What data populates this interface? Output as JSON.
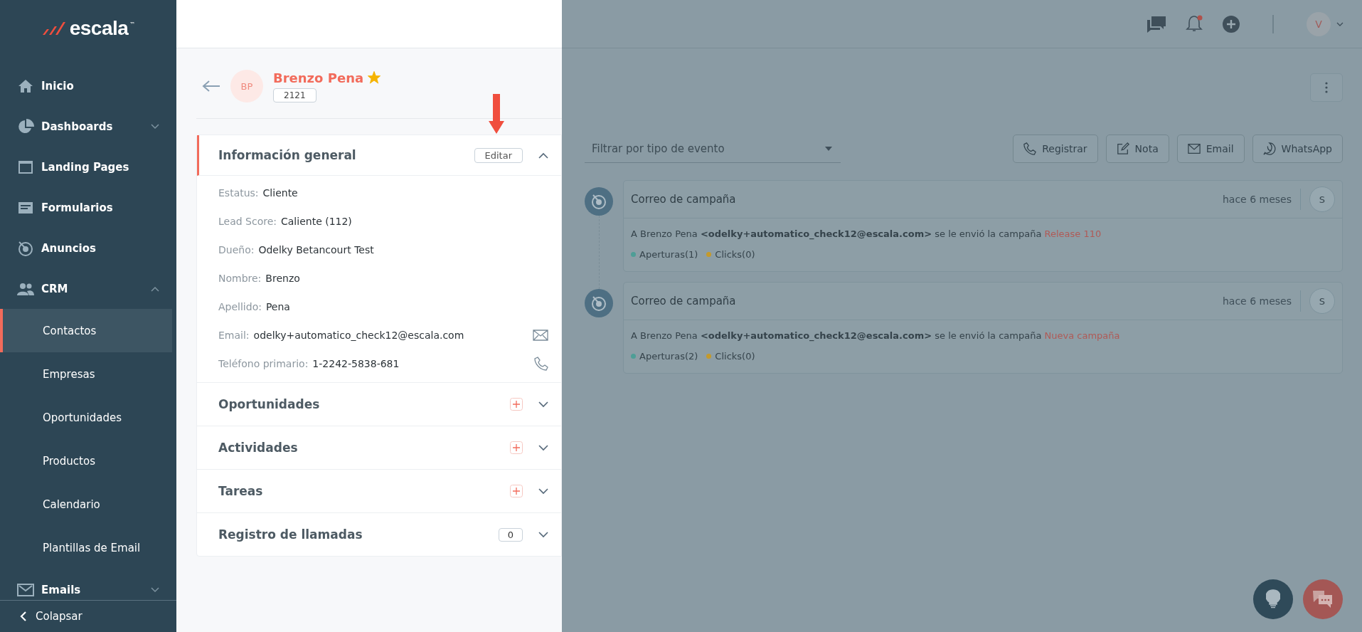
{
  "logo": {
    "text": "escala",
    "mark": "™"
  },
  "sidebar": {
    "items": [
      {
        "label": "Inicio",
        "expandable": false
      },
      {
        "label": "Dashboards",
        "expanded": false,
        "expandable": true
      },
      {
        "label": "Landing Pages",
        "expandable": false
      },
      {
        "label": "Formularios",
        "expandable": false
      },
      {
        "label": "Anuncios",
        "expandable": false
      },
      {
        "label": "CRM",
        "expanded": true,
        "expandable": true,
        "children": [
          {
            "label": "Contactos",
            "selected": true
          },
          {
            "label": "Empresas",
            "selected": false
          },
          {
            "label": "Oportunidades",
            "selected": false
          },
          {
            "label": "Productos",
            "selected": false
          },
          {
            "label": "Calendario",
            "selected": false
          },
          {
            "label": "Plantillas de Email",
            "selected": false
          }
        ]
      },
      {
        "label": "Emails",
        "expanded": false,
        "expandable": true
      }
    ],
    "collapse": "Colapsar"
  },
  "header": {
    "avatar": "V",
    "notification": true
  },
  "contact": {
    "initials": "BP",
    "name": "Brenzo Pena",
    "starred": true,
    "id": "2121",
    "info": {
      "title": "Información general",
      "edit": "Editar",
      "expanded": true,
      "fields": [
        {
          "label": "Estatus:",
          "value": "Cliente"
        },
        {
          "label": "Lead Score:",
          "value": "Caliente (112)"
        },
        {
          "label": "Dueño:",
          "value": "Odelky Betancourt Test"
        },
        {
          "label": "Nombre:",
          "value": "Brenzo"
        },
        {
          "label": "Apellido:",
          "value": "Pena"
        },
        {
          "label": "Email:",
          "value": "odelky+automatico_check12@escala.com",
          "kind": "email"
        },
        {
          "label": "Teléfono primario:",
          "value": "1-2242-5838-681",
          "kind": "phone"
        }
      ]
    },
    "sections": [
      {
        "title": "Oportunidades",
        "kind": "add",
        "expanded": false
      },
      {
        "title": "Actividades",
        "kind": "add",
        "expanded": false
      },
      {
        "title": "Tareas",
        "kind": "add",
        "expanded": false
      },
      {
        "title": "Registro de llamadas",
        "kind": "count",
        "count": "0",
        "expanded": false
      }
    ]
  },
  "timeline": {
    "filter": {
      "placeholder": "Filtrar por tipo de evento"
    },
    "actions": [
      "Registrar",
      "Nota",
      "Email",
      "WhatsApp"
    ],
    "events": [
      {
        "title": "Correo de campaña",
        "time": "hace 6 meses",
        "avatar": "S",
        "text": "A Brenzo Pena **<odelky+automatico_check12@escala.com>** se le envió la campaña",
        "campaign": "Release 110",
        "stats": [
          {
            "label": "Aperturas(1)",
            "color": "#4e9e96"
          },
          {
            "label": "Clicks(0)",
            "color": "#c49a2c"
          }
        ]
      },
      {
        "title": "Correo de campaña",
        "time": "hace 6 meses",
        "avatar": "S",
        "text": "A Brenzo Pena **<odelky+automatico_check12@escala.com>** se le envió la campaña",
        "campaign": "Nueva campaña",
        "stats": [
          {
            "label": "Aperturas(2)",
            "color": "#4e9e96"
          },
          {
            "label": "Clicks(0)",
            "color": "#c49a2c"
          }
        ]
      }
    ]
  }
}
